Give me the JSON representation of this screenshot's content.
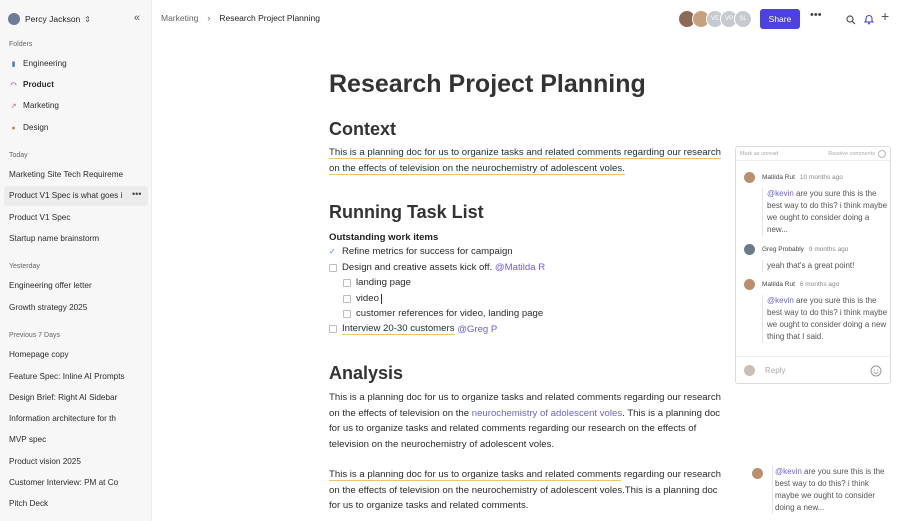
{
  "sidebar": {
    "user": "Percy Jackson",
    "folders_label": "Folders",
    "folders": [
      {
        "label": "Engineering",
        "icon": "bar-chart-icon"
      },
      {
        "label": "Product",
        "icon": "rainbow-icon"
      },
      {
        "label": "Marketing",
        "icon": "line-chart-icon"
      },
      {
        "label": "Design",
        "icon": "palette-icon"
      }
    ],
    "today_label": "Today",
    "today": [
      "Marketing Site Tech Requireme",
      "Product V1 Spec is what goes i",
      "Product V1 Spec",
      "Startup name brainstorm"
    ],
    "yesterday_label": "Yesterday",
    "yesterday": [
      "Engineering offer letter",
      "Growth strategy 2025"
    ],
    "prev7_label": "Previous 7 Days",
    "prev7": [
      "Homepage copy",
      "Feature Spec: Inline AI Prompts",
      "Design Brief: Right AI Sidebar",
      "Information architecture for th",
      "MVP spec",
      "Product vision 2025",
      "Customer Interview: PM at Co",
      "Pitch Deck"
    ]
  },
  "topbar": {
    "crumb_parent": "Marketing",
    "crumb_current": "Research Project Planning",
    "avatar_initials": [
      "VE",
      "VP",
      "SL"
    ],
    "share_label": "Share"
  },
  "doc": {
    "title": "Research Project Planning",
    "context_heading": "Context",
    "context_text": "This is a planning doc for us to organize tasks and related comments regarding our research on the effects of television on the neurochemistry of adolescent voles.",
    "tasks_heading": "Running Task List",
    "tasks_subhead": "Outstanding work items",
    "task_1": "Refine metrics for success for campaign",
    "task_2": "Design and creative assets kick off.",
    "task_2_mention": "@Matilda R",
    "task_2a": "landing page",
    "task_2b": "video",
    "task_2c": "customer references for video, landing page",
    "task_3": "Interview 20-30 customers",
    "task_3_mention": "@Greg P",
    "analysis_heading": "Analysis",
    "analysis_p1_a": "This is a planning doc for us to organize tasks and related comments regarding our research on the effects of television on the",
    "analysis_p1_link": "neurochemistry of adolescent voles",
    "analysis_p1_b": ". This is a planning doc for us to organize tasks and related comments regarding our research on the effects of television on the neurochemistry of adolescent voles.",
    "analysis_p2_hl": "This is a planning doc for us to organize tasks and related comments",
    "analysis_p2_rest": " regarding our research on the effects of television on the neurochemistry of adolescent voles.This is a planning doc for us to organize tasks and related comments."
  },
  "comments": {
    "mark_unread": "Mark as unread",
    "resolve": "Resolve comments",
    "items": [
      {
        "name": "Matilda Rut",
        "time": "10 months ago",
        "mention": "@kevin",
        "text": " are you sure this is the best way to do this? i think maybe we ought to consider doing a new..."
      },
      {
        "name": "Greg Probably",
        "time": "9 months ago",
        "mention": "",
        "text": "yeah that's a great point!"
      },
      {
        "name": "Matilda Rut",
        "time": "6 months ago",
        "mention": "@kevin",
        "text": " are you sure this is the best way to do this? i think maybe we ought to consider doing a new thing that I said."
      }
    ],
    "reply_placeholder": "Reply",
    "floating": {
      "mention": "@kevin",
      "text": " are you sure this is the best way to do this? i think maybe we ought to consider doing a new..."
    }
  }
}
